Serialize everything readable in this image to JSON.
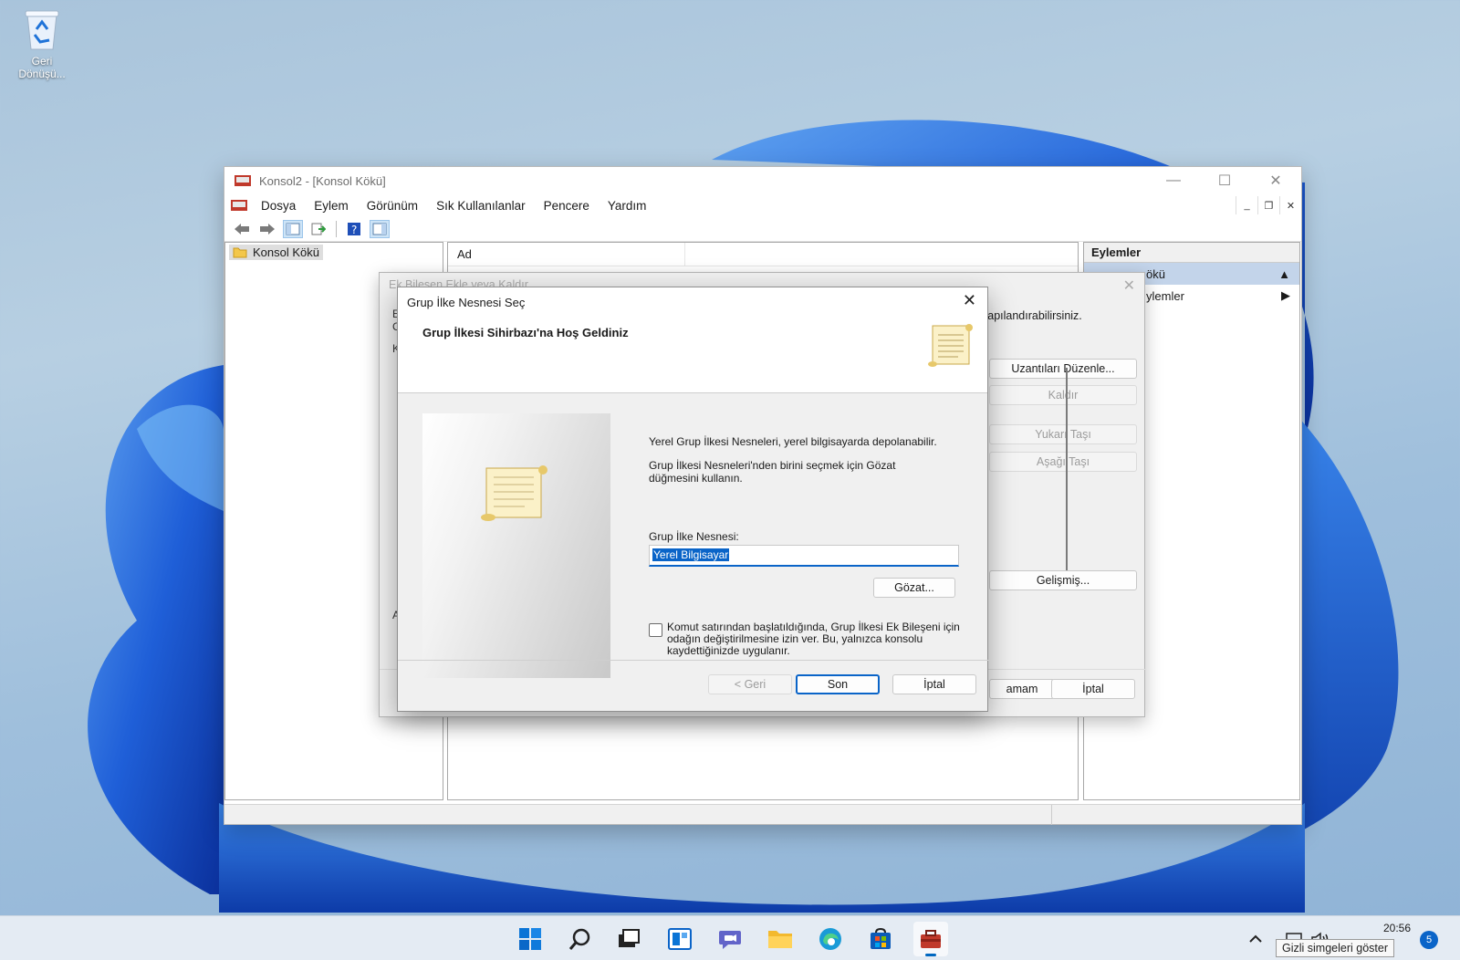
{
  "desktop": {
    "recycle_bin_label_1": "Geri",
    "recycle_bin_label_2": "Dönüşü..."
  },
  "mmc": {
    "title": "Konsol2 - [Konsol Kökü]",
    "menu": [
      "Dosya",
      "Eylem",
      "Görünüm",
      "Sık Kullanılanlar",
      "Pencere",
      "Yardım"
    ],
    "tree_root": "Konsol Kökü",
    "column_name": "Ad",
    "actions_header": "Eylemler",
    "actions_items": [
      "ökü",
      "ylemler"
    ]
  },
  "snapin_dialog": {
    "title": "Ek Bileşen Ekle veya Kaldır",
    "description_fragment": "yapılandırabilirsiniz.",
    "btn_edit_extensions": "Uzantıları Düzenle...",
    "btn_remove": "Kaldır",
    "btn_move_up": "Yukarı Taşı",
    "btn_move_down": "Aşağı Taşı",
    "btn_advanced": "Gelişmiş...",
    "btn_ok": "amam",
    "btn_cancel": "İptal",
    "frag_e": "E",
    "frag_c": "C",
    "frag_k": "K",
    "frag_a": "A"
  },
  "wizard": {
    "title": "Grup İlke Nesnesi Seç",
    "header_title": "Grup İlkesi Sihirbazı'na Hoş Geldiniz",
    "text_1": "Yerel Grup İlkesi Nesneleri, yerel bilgisayarda depolanabilir.",
    "text_2": "Grup İlkesi Nesneleri'nden birini seçmek için Gözat düğmesini kullanın.",
    "gpo_label": "Grup İlke Nesnesi:",
    "gpo_value": "Yerel Bilgisayar",
    "browse_button": "Gözat...",
    "checkbox_checked": false,
    "checkbox_text": "Komut satırından başlatıldığında, Grup İlkesi Ek Bileşeni için odağın değiştirilmesine izin ver.  Bu, yalnızca konsolu kaydettiğinizde uygulanır.",
    "back_button": "< Geri",
    "finish_button": "Son",
    "cancel_button": "İptal"
  },
  "taskbar": {
    "time": "20:56",
    "notification_count": "5",
    "tooltip": "Gizli simgeleri göster",
    "accent": "#0067c0"
  }
}
